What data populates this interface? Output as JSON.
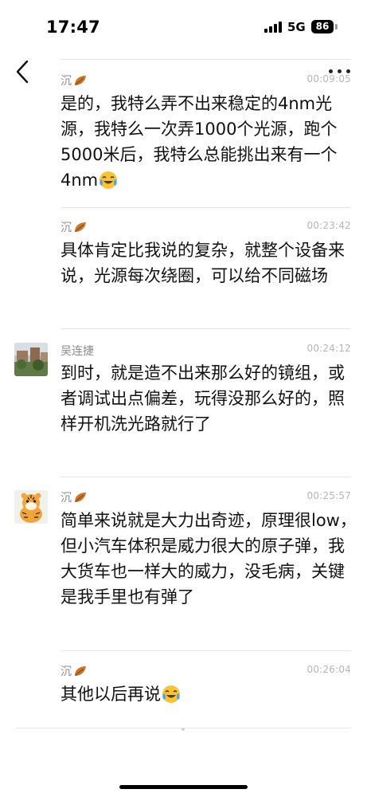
{
  "status_bar": {
    "time": "17:47",
    "network": "5G",
    "battery": "86"
  },
  "nav": {
    "back_icon": "chevron-left-icon",
    "more_icon": "more-dots-icon"
  },
  "messages": [
    {
      "sender": "沉",
      "sender_icon": "leaf-icon",
      "time": "00:09:05",
      "text": "是的，我特么弄不出来稳定的4nm光源，我特么一次弄1000个光源，跑个5000米后，我特么总能挑出来有一个4nm",
      "trailing_emoji": "laughing-crying-emoji-icon"
    },
    {
      "sender": "沉",
      "sender_icon": "leaf-icon",
      "time": "00:23:42",
      "text": "具体肯定比我说的复杂，就整个设备来说，光源每次绕圈，可以给不同磁场"
    },
    {
      "sender": "吴连捷",
      "time": "00:24:12",
      "avatar": "building-photo-avatar",
      "text": "到时，就是造不出来那么好的镜组，或者调试出点偏差，玩得没那么好的，照样开机洗光路就行了"
    },
    {
      "sender": "沉",
      "sender_icon": "leaf-icon",
      "time": "00:25:57",
      "avatar": "tiger-cartoon-avatar",
      "text": "简单来说就是大力出奇迹，原理很low，但小汽车体积是威力很大的原子弹，我大货车也一样大的威力，没毛病，关键是我手里也有弹了"
    },
    {
      "sender": "沉",
      "sender_icon": "leaf-icon",
      "time": "00:26:04",
      "text": "其他以后再说",
      "trailing_emoji": "laughing-crying-emoji-icon"
    }
  ]
}
